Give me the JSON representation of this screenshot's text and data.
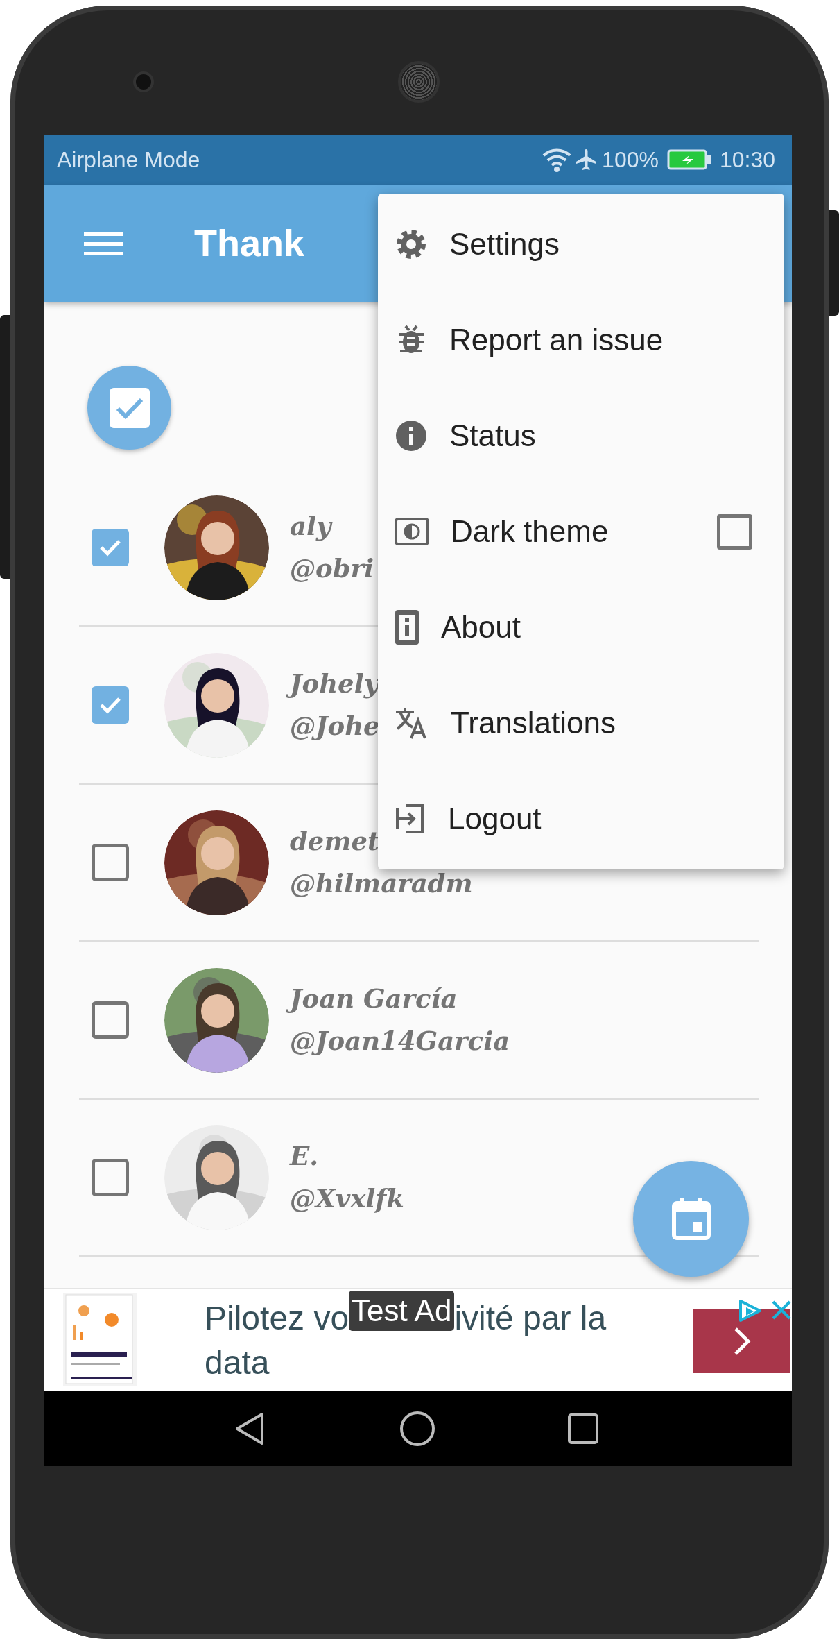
{
  "status_bar": {
    "carrier": "Airplane Mode",
    "battery": "100%",
    "time": "10:30"
  },
  "app_bar": {
    "title": "Thank"
  },
  "contacts": [
    {
      "name": "aly",
      "handle": "@obri",
      "checked": true
    },
    {
      "name": "Johely",
      "handle": "@Johe",
      "checked": true
    },
    {
      "name": "demet",
      "handle": "@hilmaradm",
      "checked": false
    },
    {
      "name": "Joan García",
      "handle": "@Joan14Garcia",
      "checked": false
    },
    {
      "name": "E.",
      "handle": "@Xvxlfk",
      "checked": false
    }
  ],
  "menu": {
    "items": [
      {
        "kind": "action",
        "label": "Settings"
      },
      {
        "kind": "action",
        "label": "Report an issue"
      },
      {
        "kind": "action",
        "label": "Status"
      },
      {
        "kind": "toggle",
        "label": "Dark theme",
        "checked": false
      },
      {
        "kind": "action",
        "label": "About"
      },
      {
        "kind": "action",
        "label": "Translations"
      },
      {
        "kind": "action",
        "label": "Logout"
      }
    ]
  },
  "ad": {
    "badge": "Test Ad",
    "headline_parts": [
      "Pilotez vo",
      "ivité par la",
      "data"
    ]
  }
}
